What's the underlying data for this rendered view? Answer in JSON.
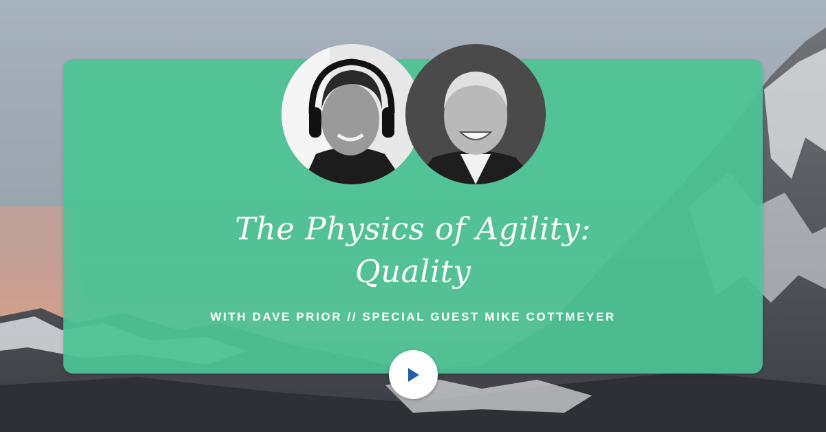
{
  "episode": {
    "title_line1": "The Physics of Agility:",
    "title_line2": "Quality",
    "subtitle": "WITH DAVE PRIOR // SPECIAL GUEST MIKE COTTMEYER"
  },
  "hosts": [
    {
      "role": "host",
      "icon": "person-with-headphones-photo"
    },
    {
      "role": "guest",
      "icon": "person-in-suit-photo"
    }
  ],
  "player": {
    "icon": "play-icon"
  },
  "colors": {
    "card": "#4cc494",
    "play_icon": "#1f5fae",
    "text": "#ffffff"
  }
}
